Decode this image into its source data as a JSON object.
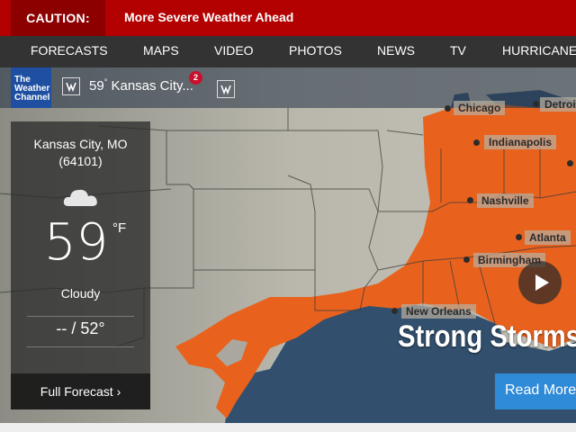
{
  "alert": {
    "label": "CAUTION:",
    "message": "More Severe Weather Ahead"
  },
  "nav": {
    "items": [
      "FORECASTS",
      "MAPS",
      "VIDEO",
      "PHOTOS",
      "NEWS",
      "TV",
      "HURRICANE"
    ]
  },
  "brand": {
    "line1": "The",
    "line2": "Weather",
    "line3": "Channel"
  },
  "location_bar": {
    "temp": "59",
    "degree": "°",
    "city": "Kansas City...",
    "notifications": "2"
  },
  "current": {
    "city": "Kansas City, MO",
    "zip": "(64101)",
    "icon": "cloud-icon",
    "temp": "59",
    "unit": "°F",
    "condition": "Cloudy",
    "hilo": "-- / 52°",
    "full_forecast": "Full Forecast ›"
  },
  "map": {
    "cities": [
      "Chicago",
      "Detroit",
      "Indianapolis",
      "Nashville",
      "Atlanta",
      "Birmingham",
      "New Orleans"
    ],
    "colors": {
      "land": "#b5b3a8",
      "water": "#32506e",
      "risk": "#e8621e"
    }
  },
  "story": {
    "headline": "Strong Storms",
    "read_more": "Read More"
  }
}
